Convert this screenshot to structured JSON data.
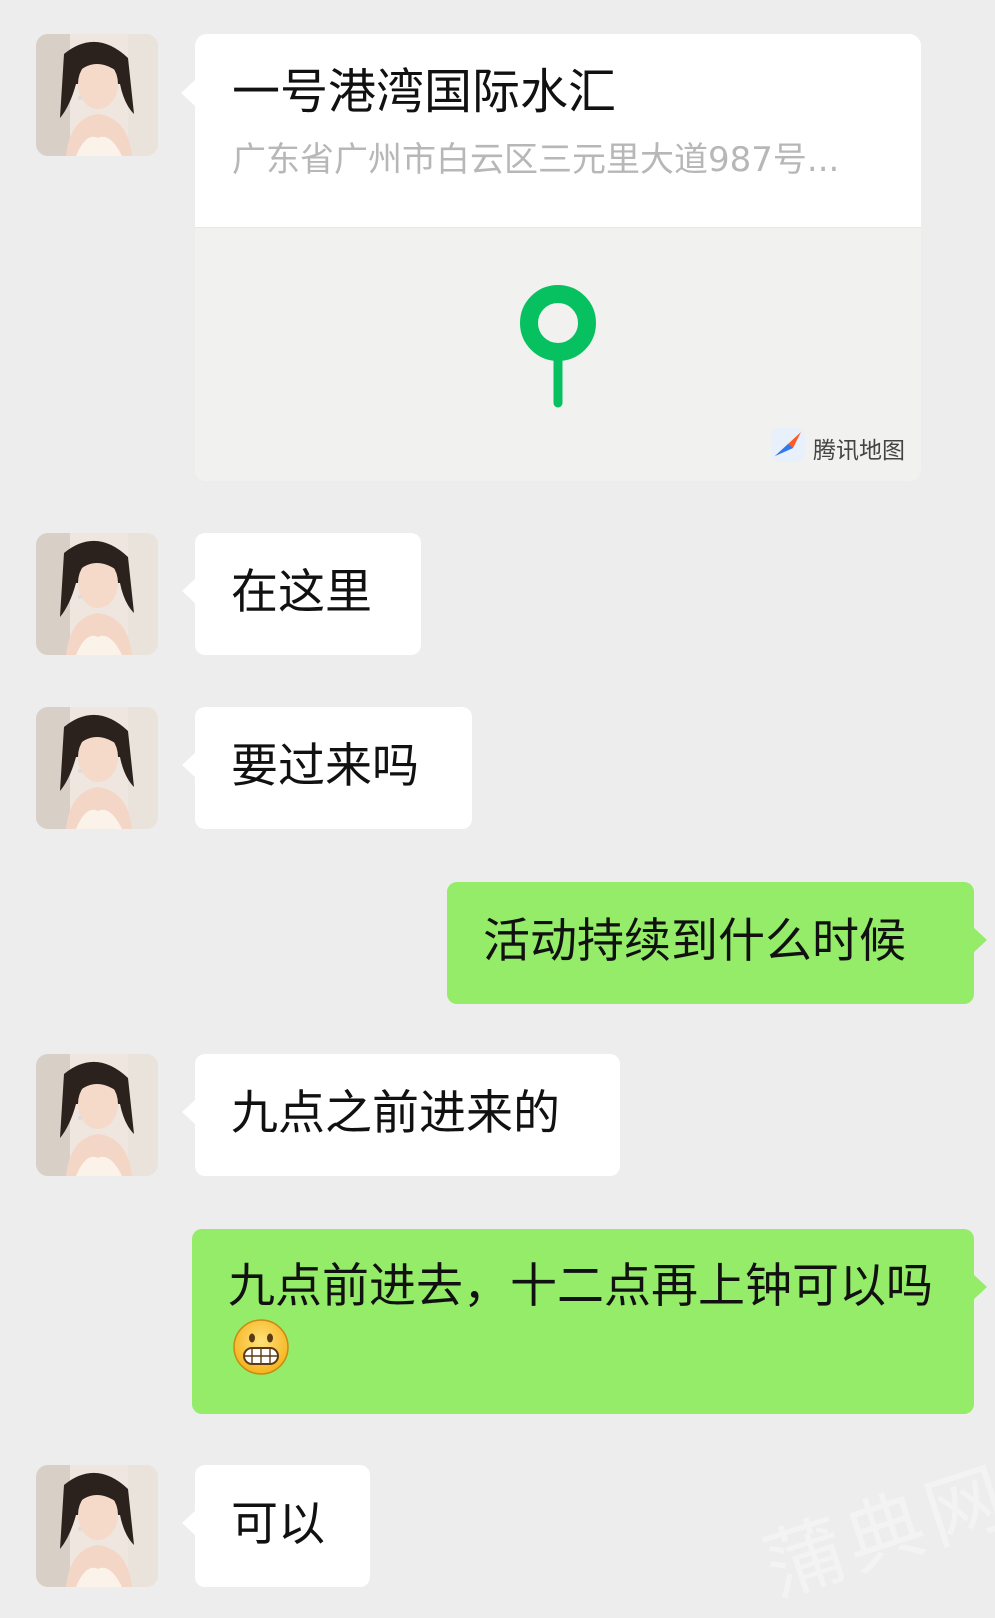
{
  "location_message": {
    "title": "一号港湾国际水汇",
    "address": "广东省广州市白云区三元里大道987号...",
    "map_provider": "腾讯地图",
    "pin_color": "#07c160"
  },
  "messages": [
    {
      "side": "received",
      "text": "在这里"
    },
    {
      "side": "received",
      "text": "要过来吗"
    },
    {
      "side": "sent",
      "text": "活动持续到什么时候"
    },
    {
      "side": "received",
      "text": "九点之前进来的"
    },
    {
      "side": "sent",
      "text": "九点前进去，十二点再上钟可以吗",
      "emoji": "grinning-teeth-emoji"
    },
    {
      "side": "received",
      "text": "可以"
    }
  ],
  "colors": {
    "background": "#ededed",
    "received_bubble": "#ffffff",
    "sent_bubble": "#95ec69"
  },
  "watermark": "蒲典网"
}
